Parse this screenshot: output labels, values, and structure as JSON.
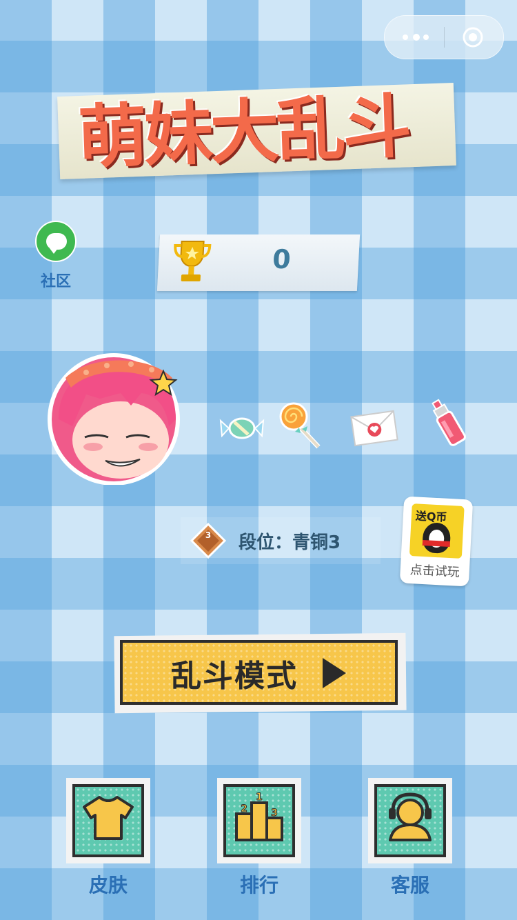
{
  "capsule": {
    "more_icon": "more-dots-icon",
    "close_icon": "target-circle-icon"
  },
  "title": {
    "text": "萌妹大乱斗"
  },
  "community": {
    "label": "社区",
    "icon": "chat-bubble-icon"
  },
  "score": {
    "value": "0",
    "icon": "trophy-icon"
  },
  "items": [
    "candy-icon",
    "lollipop-icon",
    "love-letter-icon",
    "perfume-bottle-icon"
  ],
  "rank": {
    "text": "段位：青铜3",
    "badge_number": "3"
  },
  "ad": {
    "badge_text": "送Q币",
    "cta": "点击试玩"
  },
  "mode_button": {
    "label": "乱斗模式"
  },
  "bottom_nav": [
    {
      "label": "皮肤",
      "icon": "tshirt-icon"
    },
    {
      "label": "排行",
      "icon": "podium-icon"
    },
    {
      "label": "客服",
      "icon": "support-agent-icon"
    }
  ],
  "podium_numbers": [
    "1",
    "2",
    "3"
  ],
  "colors": {
    "accent_yellow": "#f7c64a",
    "tile_teal": "#5ec9b0",
    "label_blue": "#2a6fb5",
    "title_red": "#f36a4a"
  }
}
